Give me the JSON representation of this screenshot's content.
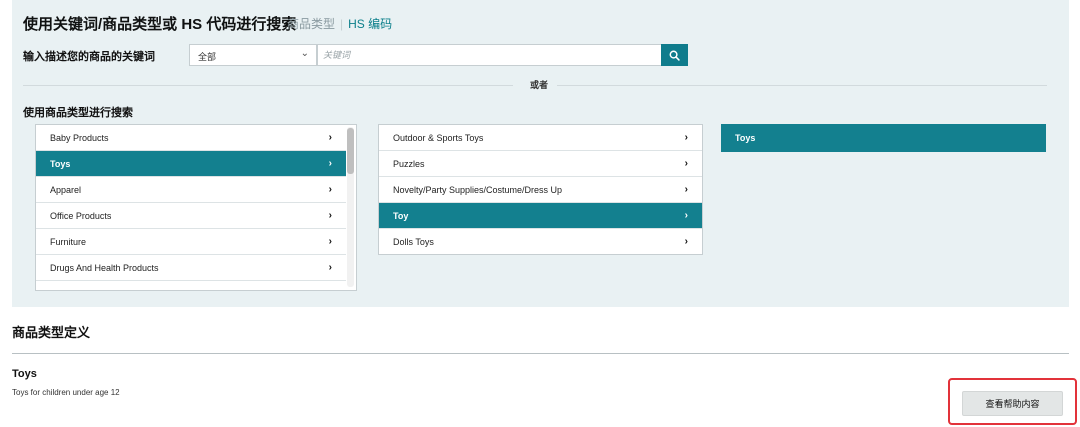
{
  "search": {
    "title": "使用关键词/商品类型或 HS 代码进行搜索",
    "tab_product_type": "商品类型",
    "tab_hs_code": "HS 编码",
    "keyword_label": "输入描述您的商品的关键词",
    "category_select": "全部",
    "keyword_placeholder": "关键词",
    "keyword_value": "",
    "or_text": "或者",
    "by_type_label": "使用商品类型进行搜索"
  },
  "columns": [
    {
      "items": [
        {
          "label": "Baby Products",
          "selected": false
        },
        {
          "label": "Toys",
          "selected": true
        },
        {
          "label": "Apparel",
          "selected": false
        },
        {
          "label": "Office Products",
          "selected": false
        },
        {
          "label": "Furniture",
          "selected": false
        },
        {
          "label": "Drugs And Health Products",
          "selected": false
        },
        {
          "label": "",
          "selected": false
        }
      ]
    },
    {
      "items": [
        {
          "label": "Outdoor & Sports Toys",
          "selected": false
        },
        {
          "label": "Puzzles",
          "selected": false
        },
        {
          "label": "Novelty/Party Supplies/Costume/Dress Up",
          "selected": false
        },
        {
          "label": "Toy",
          "selected": true
        },
        {
          "label": "Dolls Toys",
          "selected": false
        }
      ]
    },
    {
      "items": [
        {
          "label": "Toys",
          "selected": true
        }
      ]
    }
  ],
  "definition": {
    "title": "商品类型定义",
    "name": "Toys",
    "description": "Toys for children under age 12",
    "help_button": "查看帮助内容"
  },
  "colors": {
    "accent": "#13808f",
    "panel_bg": "#e9f1f3",
    "result_bg": "#88c3bd",
    "highlight": "#e2323a"
  },
  "icons": {
    "search": "search-icon",
    "chevron": "chevron-right-icon",
    "dropdown": "chevron-down-icon"
  }
}
